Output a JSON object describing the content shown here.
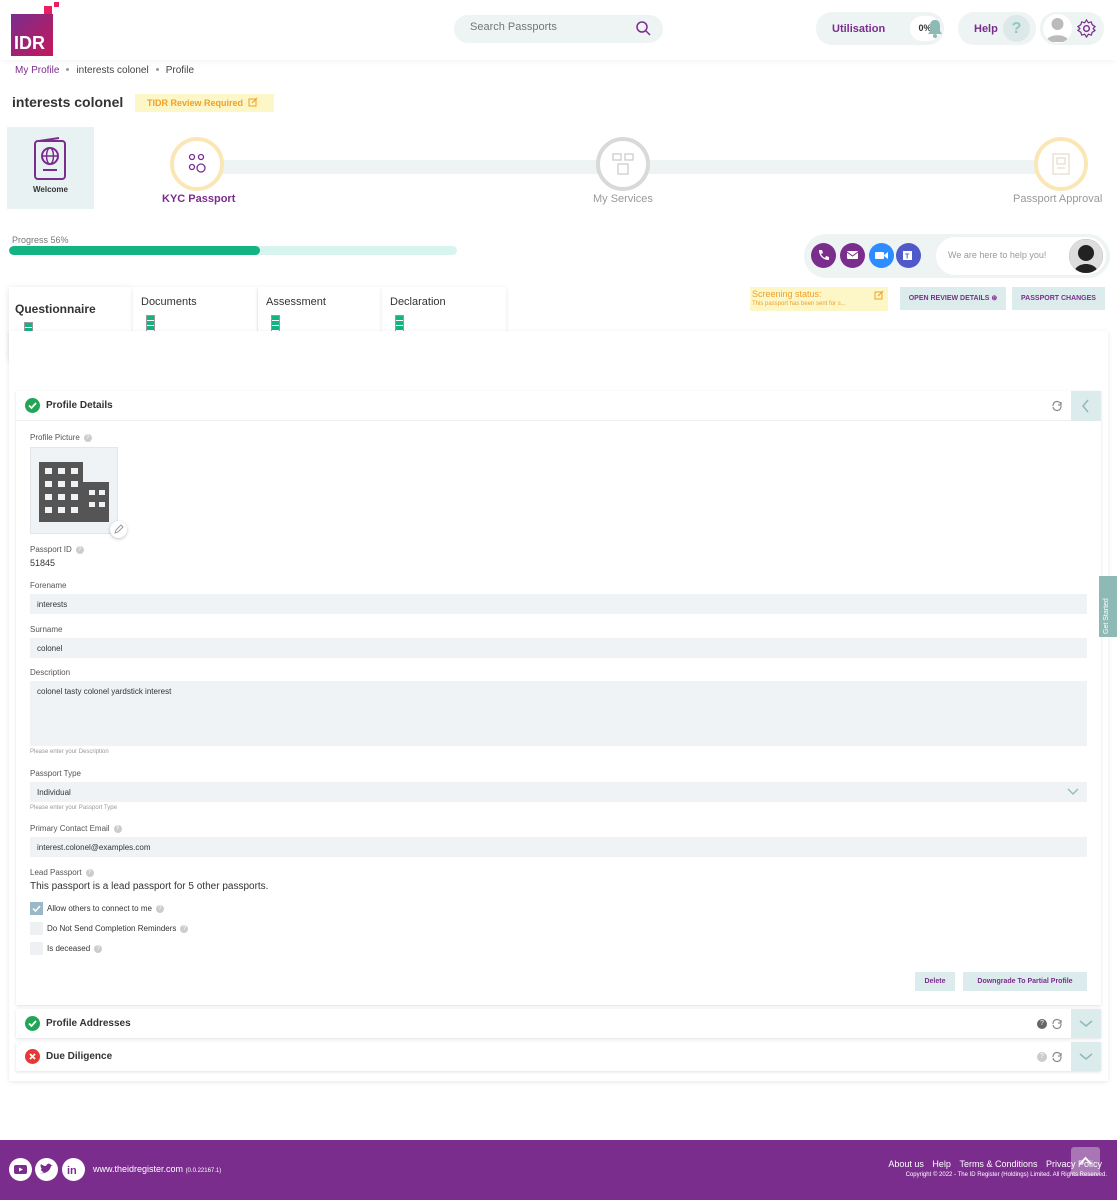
{
  "header": {
    "logo_text": "IDR",
    "search_placeholder": "Search Passports",
    "utilisation_label": "Utilisation",
    "utilisation_value": "0%",
    "help_label": "Help",
    "help_icon": "?"
  },
  "breadcrumb": [
    "My Profile",
    "interests colonel",
    "Profile"
  ],
  "title": "interests colonel",
  "review_badge": "TIDR Review Required",
  "steps": {
    "welcome": "Welcome",
    "kyc": "KYC Passport",
    "services": "My Services",
    "approval": "Passport Approval"
  },
  "progress": {
    "label": "Progress 56%",
    "value": 0.56
  },
  "contact": {
    "help_text": "We are here to help you!"
  },
  "tabs": [
    "Questionnaire",
    "Documents",
    "Assessment",
    "Declaration"
  ],
  "screening": {
    "label": "Screening status:",
    "detail": "This passport has been sent for s..."
  },
  "actions": {
    "open_review": "OPEN REVIEW DETAILS ⊛",
    "passport_changes": "PASSPORT CHANGES"
  },
  "profile": {
    "section_title": "Profile Details",
    "picture_label": "Profile Picture",
    "passport_id_label": "Passport ID",
    "passport_id": "51845",
    "forename_label": "Forename",
    "forename": "interests",
    "surname_label": "Surname",
    "surname": "colonel",
    "description_label": "Description",
    "description": "colonel tasty colonel yardstick interest",
    "description_hint": "Please enter your Description",
    "passport_type_label": "Passport Type",
    "passport_type": "Individual",
    "passport_type_hint": "Please enter your Passport Type",
    "email_label": "Primary Contact Email",
    "email": "interest.colonel@examples.com",
    "lead_label": "Lead Passport",
    "lead_text": "This passport is a lead passport for 5 other passports.",
    "checkboxes": [
      {
        "label": "Allow others to connect to me",
        "checked": true
      },
      {
        "label": "Do Not Send Completion Reminders",
        "checked": false
      },
      {
        "label": "Is deceased",
        "checked": false
      }
    ],
    "delete_label": "Delete",
    "downgrade_label": "Downgrade To Partial Profile"
  },
  "sections": {
    "addresses": "Profile Addresses",
    "due_diligence": "Due Diligence"
  },
  "get_started": "Get Started",
  "footer": {
    "site": "www.theidregister.com",
    "version": "(0.0.22167.1)",
    "links": [
      "About us",
      "Help",
      "Terms & Conditions",
      "Privacy Policy"
    ],
    "copyright": "Copyright © 2022 - The ID Register (Holdings) Limited. All Rights Reserved."
  },
  "colors": {
    "brand": "#7b2d8e",
    "accent": "#14b383",
    "teal_bg": "#dcecec",
    "warn": "#f0a02a"
  }
}
